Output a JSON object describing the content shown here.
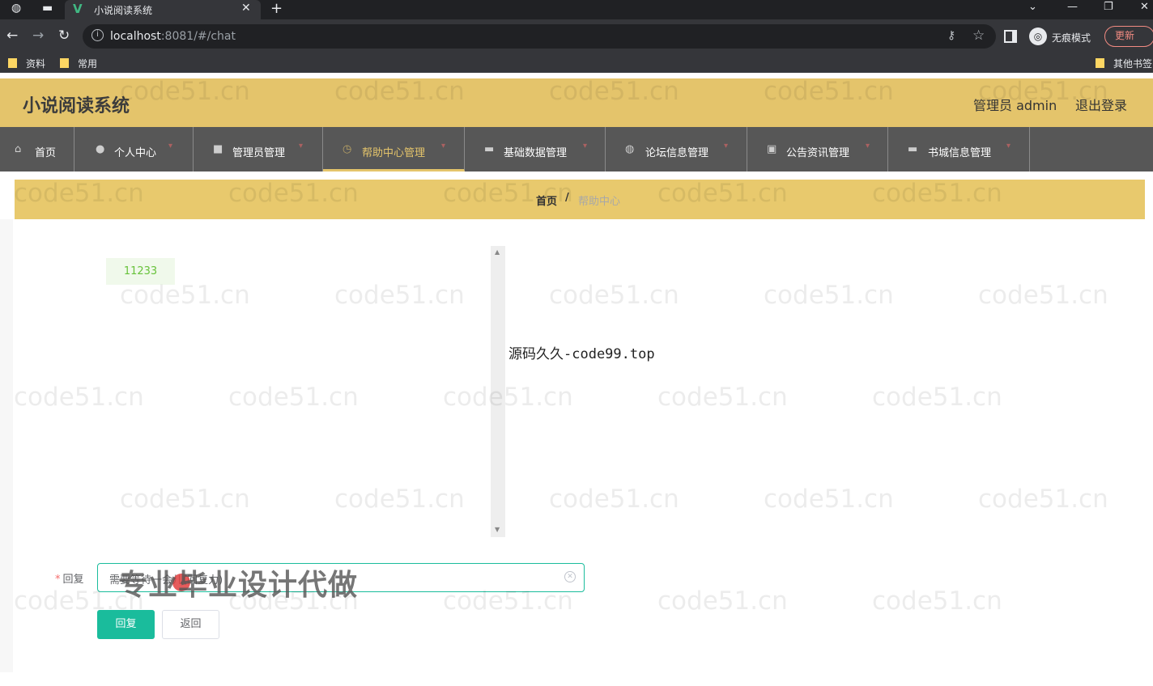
{
  "browser": {
    "tab_title": "小说阅读系统",
    "url_host": "localhost",
    "url_rest": ":8081/#/chat",
    "incognito_label": "无痕模式",
    "update_label": "更新",
    "bookmarks": [
      "资料",
      "常用"
    ],
    "other_bookmarks": "其他书签"
  },
  "header": {
    "title": "小说阅读系统",
    "user": "管理员 admin",
    "logout": "退出登录"
  },
  "menu": [
    {
      "label": "首页",
      "icon": "home-icon"
    },
    {
      "label": "个人中心",
      "icon": "user-icon"
    },
    {
      "label": "管理员管理",
      "icon": "folder-icon"
    },
    {
      "label": "帮助中心管理",
      "icon": "clock-icon",
      "active": true
    },
    {
      "label": "基础数据管理",
      "icon": "monitor-icon"
    },
    {
      "label": "论坛信息管理",
      "icon": "globe-icon"
    },
    {
      "label": "公告资讯管理",
      "icon": "doc-icon"
    },
    {
      "label": "书城信息管理",
      "icon": "monitor-icon"
    }
  ],
  "breadcrumb": {
    "home": "首页",
    "separator": "/",
    "current": "帮助中心"
  },
  "chat": {
    "messages": [
      "11233"
    ]
  },
  "site_label": "源码久久-code99.top",
  "form": {
    "reply_label": "回复",
    "reply_value": "需要等待一会儿(回复力)",
    "reply_button": "回复",
    "back_button": "返回"
  },
  "overlay": "专业毕业设计代做",
  "watermark": "code51.cn",
  "colors": {
    "header_bg": "#e4c46b",
    "menu_bg": "#575757",
    "accent": "#1abc9c"
  }
}
